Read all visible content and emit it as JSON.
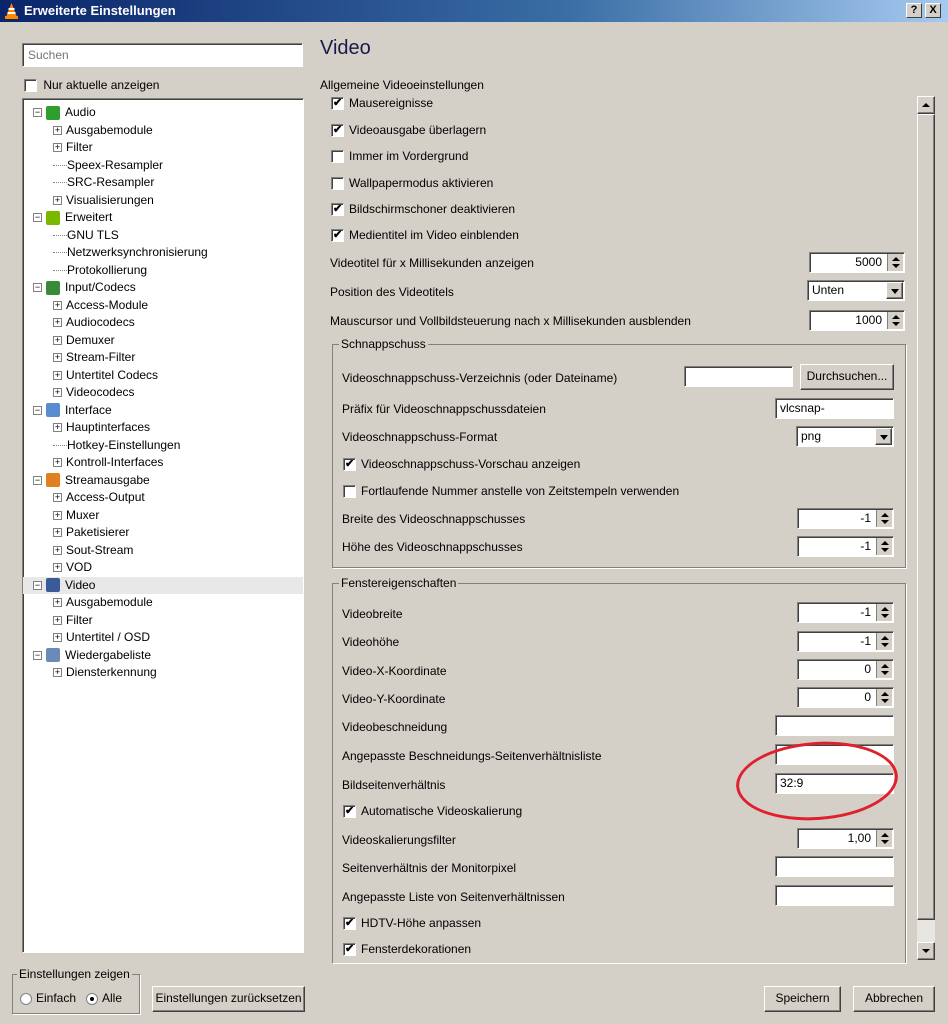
{
  "window": {
    "title": "Erweiterte Einstellungen",
    "help_label": "?",
    "close_label": "X"
  },
  "search": {
    "placeholder": "Suchen"
  },
  "only_current": {
    "label": "Nur aktuelle anzeigen",
    "checked": false
  },
  "tree": [
    {
      "label": "Audio",
      "level": 0,
      "icon": "audio-icon",
      "expand": "minus"
    },
    {
      "label": "Ausgabemodule",
      "level": 1,
      "expand": "plus"
    },
    {
      "label": "Filter",
      "level": 1,
      "expand": "plus"
    },
    {
      "label": "Speex-Resampler",
      "level": 1,
      "expand": ""
    },
    {
      "label": "SRC-Resampler",
      "level": 1,
      "expand": ""
    },
    {
      "label": "Visualisierungen",
      "level": 1,
      "expand": "plus"
    },
    {
      "label": "Erweitert",
      "level": 0,
      "icon": "advanced-icon",
      "expand": "minus"
    },
    {
      "label": "GNU TLS",
      "level": 1,
      "expand": ""
    },
    {
      "label": "Netzwerksynchronisierung",
      "level": 1,
      "expand": ""
    },
    {
      "label": "Protokollierung",
      "level": 1,
      "expand": ""
    },
    {
      "label": "Input/Codecs",
      "level": 0,
      "icon": "input-codecs-icon",
      "expand": "minus"
    },
    {
      "label": "Access-Module",
      "level": 1,
      "expand": "plus"
    },
    {
      "label": "Audiocodecs",
      "level": 1,
      "expand": "plus"
    },
    {
      "label": "Demuxer",
      "level": 1,
      "expand": "plus"
    },
    {
      "label": "Stream-Filter",
      "level": 1,
      "expand": "plus"
    },
    {
      "label": "Untertitel Codecs",
      "level": 1,
      "expand": "plus"
    },
    {
      "label": "Videocodecs",
      "level": 1,
      "expand": "plus"
    },
    {
      "label": "Interface",
      "level": 0,
      "icon": "interface-icon",
      "expand": "minus"
    },
    {
      "label": "Hauptinterfaces",
      "level": 1,
      "expand": "plus"
    },
    {
      "label": "Hotkey-Einstellungen",
      "level": 1,
      "expand": ""
    },
    {
      "label": "Kontroll-Interfaces",
      "level": 1,
      "expand": "plus"
    },
    {
      "label": "Streamausgabe",
      "level": 0,
      "icon": "stream-output-icon",
      "expand": "minus"
    },
    {
      "label": "Access-Output",
      "level": 1,
      "expand": "plus"
    },
    {
      "label": "Muxer",
      "level": 1,
      "expand": "plus"
    },
    {
      "label": "Paketisierer",
      "level": 1,
      "expand": "plus"
    },
    {
      "label": "Sout-Stream",
      "level": 1,
      "expand": "plus"
    },
    {
      "label": "VOD",
      "level": 1,
      "expand": "plus"
    },
    {
      "label": "Video",
      "level": 0,
      "icon": "video-icon",
      "expand": "minus",
      "selected": true
    },
    {
      "label": "Ausgabemodule",
      "level": 1,
      "expand": "plus"
    },
    {
      "label": "Filter",
      "level": 1,
      "expand": "plus"
    },
    {
      "label": "Untertitel / OSD",
      "level": 1,
      "expand": "plus"
    },
    {
      "label": "Wiedergabeliste",
      "level": 0,
      "icon": "playlist-icon",
      "expand": "minus"
    },
    {
      "label": "Diensterkennung",
      "level": 1,
      "expand": "plus"
    }
  ],
  "colors": {
    "tree_icon_audio": "#2e9e2e",
    "tree_icon_erweitert": "#7ab800",
    "tree_icon_input": "#3a8a3a",
    "tree_icon_interface": "#5a8ad0",
    "tree_icon_stream": "#e08020",
    "tree_icon_video": "#3a5a9a",
    "tree_icon_playlist": "#6a8ab8",
    "highlight": "#e0202c"
  },
  "main": {
    "heading": "Video",
    "section_label": "Allgemeine Videoeinstellungen",
    "general_checks": [
      {
        "label": "Mausereignisse",
        "checked": true
      },
      {
        "label": "Videoausgabe überlagern",
        "checked": true
      },
      {
        "label": "Immer im Vordergrund",
        "checked": false
      },
      {
        "label": "Wallpapermodus aktivieren",
        "checked": false
      },
      {
        "label": "Bildschirmschoner deaktivieren",
        "checked": true
      },
      {
        "label": "Medientitel im Video einblenden",
        "checked": true
      }
    ],
    "title_ms": {
      "label": "Videotitel für x Millisekunden anzeigen",
      "value": "5000"
    },
    "title_pos": {
      "label": "Position des Videotitels",
      "value": "Unten"
    },
    "mouse_hide": {
      "label": "Mauscursor und Vollbildsteuerung nach x Millisekunden ausblenden",
      "value": "1000"
    },
    "snapshot": {
      "title": "Schnappschuss",
      "dir_label": "Videoschnappschuss-Verzeichnis (oder Dateiname)",
      "dir_value": "",
      "browse": "Durchsuchen...",
      "prefix_label": "Präfix für Videoschnappschussdateien",
      "prefix_value": "vlcsnap-",
      "format_label": "Videoschnappschuss-Format",
      "format_value": "png",
      "preview_label": "Videoschnappschuss-Vorschau anzeigen",
      "preview_checked": true,
      "sequential_label": "Fortlaufende Nummer anstelle von Zeitstempeln verwenden",
      "sequential_checked": false,
      "width_label": "Breite des Videoschnappschusses",
      "width_value": "-1",
      "height_label": "Höhe des Videoschnappschusses",
      "height_value": "-1"
    },
    "window": {
      "title": "Fenstereigenschaften",
      "width_label": "Videobreite",
      "width_value": "-1",
      "height_label": "Videohöhe",
      "height_value": "-1",
      "x_label": "Video-X-Koordinate",
      "x_value": "0",
      "y_label": "Video-Y-Koordinate",
      "y_value": "0",
      "crop_label": "Videobeschneidung",
      "crop_value": "",
      "crop_list_label": "Angepasste Beschneidungs-Seitenverhältnisliste",
      "crop_list_value": "",
      "aspect_label": "Bildseitenverhältnis",
      "aspect_value": "32:9",
      "autoscale_label": "Automatische Videoskalierung",
      "autoscale_checked": true,
      "scale_label": "Videoskalierungsfilter",
      "scale_value": "1,00",
      "pixel_ratio_label": "Seitenverhältnis der Monitorpixel",
      "pixel_ratio_value": "",
      "ratio_list_label": "Angepasste Liste von Seitenverhältnissen",
      "ratio_list_value": "",
      "hdtv_label": "HDTV-Höhe anpassen",
      "hdtv_checked": true,
      "deco_label": "Fensterdekorationen",
      "deco_checked": true
    }
  },
  "footer": {
    "show_settings": "Einstellungen zeigen",
    "simple": "Einfach",
    "all": "Alle",
    "selected_mode": "Alle",
    "reset": "Einstellungen zurücksetzen",
    "save": "Speichern",
    "cancel": "Abbrechen"
  }
}
